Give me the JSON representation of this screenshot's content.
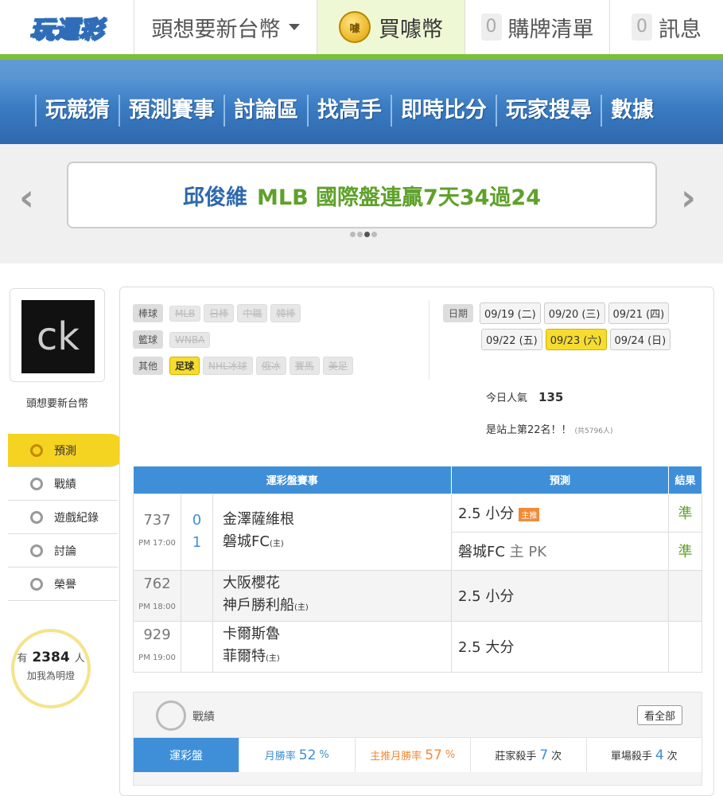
{
  "header": {
    "logo": "玩運彩",
    "username": "頭想要新台幣",
    "buy": "買噱幣",
    "coin_label": "噱",
    "cart_count": "0",
    "cart_label": "購牌清單",
    "msg_count": "0",
    "msg_label": "訊息"
  },
  "nav": [
    "玩競猜",
    "預測賽事",
    "討論區",
    "找高手",
    "即時比分",
    "玩家搜尋",
    "數據"
  ],
  "banner": {
    "name": "邱俊維",
    "text": "MLB 國際盤連贏7天34過24"
  },
  "profile": {
    "avatar_text": "ck",
    "username": "頭想要新台幣"
  },
  "sidebar": [
    "預測",
    "戰績",
    "遊戲紀錄",
    "討論",
    "榮譽"
  ],
  "fans": {
    "prefix": "有",
    "count": "2384",
    "unit": "人",
    "label": "加我為明燈"
  },
  "filters": {
    "baseball": {
      "label": "棒球",
      "tags": [
        "MLB",
        "日棒",
        "中職",
        "韓棒"
      ]
    },
    "basketball": {
      "label": "籃球",
      "tags": [
        "WNBA"
      ]
    },
    "other": {
      "label": "其他",
      "selected": "足球",
      "tags": [
        "NHL冰球",
        "俄冰",
        "賽馬",
        "美足"
      ]
    }
  },
  "dates": {
    "label": "日期",
    "row1": [
      "09/19 (二)",
      "09/20 (三)",
      "09/21 (四)"
    ],
    "row2": [
      "09/22 (五)",
      "09/23 (六)",
      "09/24 (日)"
    ]
  },
  "popularity": {
    "label": "今日人氣",
    "value": "135",
    "rank": "是站上第22名！！",
    "total": "(共5796人)"
  },
  "table": {
    "headers": [
      "運彩盤賽事",
      "預測",
      "結果"
    ],
    "games": [
      {
        "no": "737",
        "time": "PM 17:00",
        "s1": "0",
        "s2": "1",
        "t1": "金澤薩維根",
        "t2": "磐城FC",
        "home": "(主)",
        "p1": "2.5 小分",
        "hint": "主推",
        "p2a": "磐城FC",
        "p2b": "主 PK",
        "r1": "準",
        "r2": "準"
      },
      {
        "no": "762",
        "time": "PM 18:00",
        "t1": "大阪櫻花",
        "t2": "神戶勝利船",
        "home": "(主)",
        "p1": "2.5 小分"
      },
      {
        "no": "929",
        "time": "PM 19:00",
        "t1": "卡爾斯魯",
        "t2": "菲爾特",
        "home": "(主)",
        "p1": "2.5 大分"
      }
    ]
  },
  "record": {
    "title": "戰績",
    "see_all": "看全部",
    "tab": "運彩盤",
    "month_label": "月勝率",
    "month_value": "52",
    "month_unit": "%",
    "main_label": "主推月勝率",
    "main_value": "57",
    "main_unit": "%",
    "banker_label": "莊家殺手",
    "banker_value": "7",
    "banker_unit": "次",
    "single_label": "單場殺手",
    "single_value": "4",
    "single_unit": "次"
  }
}
